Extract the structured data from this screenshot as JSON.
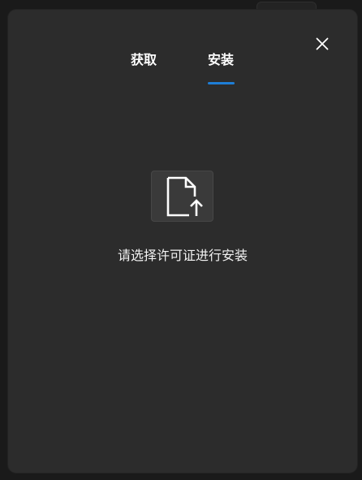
{
  "dialog": {
    "tabs": [
      {
        "label": "获取",
        "active": false
      },
      {
        "label": "安装",
        "active": true
      }
    ],
    "prompt": "请选择许可证进行安装"
  },
  "icons": {
    "close": "close-icon",
    "upload": "file-upload-icon"
  },
  "colors": {
    "accent": "#1e7ed6",
    "dialog_bg": "#2c2c2c",
    "text": "#ffffff"
  }
}
